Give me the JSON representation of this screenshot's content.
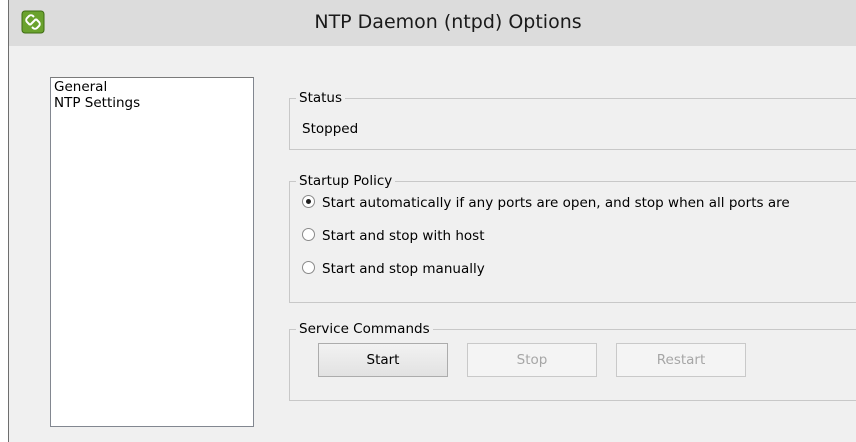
{
  "window": {
    "title": "NTP Daemon (ntpd) Options"
  },
  "nav": {
    "items": [
      {
        "label": "General"
      },
      {
        "label": "NTP Settings"
      }
    ]
  },
  "status": {
    "legend": "Status",
    "value": "Stopped"
  },
  "startup_policy": {
    "legend": "Startup Policy",
    "options": [
      {
        "label": "Start automatically if any ports are open, and stop when all ports are",
        "checked": true
      },
      {
        "label": "Start and stop with host",
        "checked": false
      },
      {
        "label": "Start and stop manually",
        "checked": false
      }
    ]
  },
  "service_commands": {
    "legend": "Service Commands",
    "buttons": [
      {
        "label": "Start",
        "enabled": true
      },
      {
        "label": "Stop",
        "enabled": false
      },
      {
        "label": "Restart",
        "enabled": false
      }
    ]
  }
}
